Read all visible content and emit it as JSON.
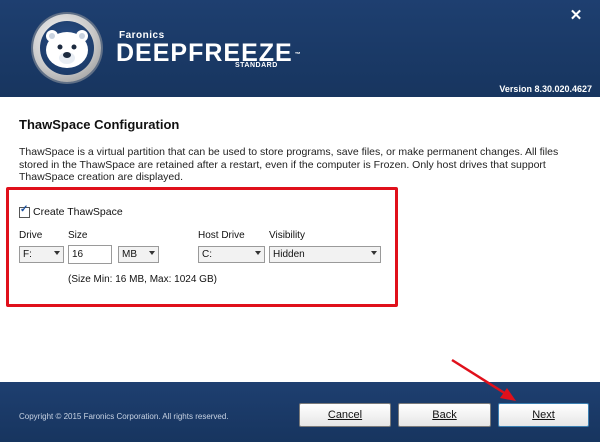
{
  "header": {
    "brand_small": "Faronics",
    "brand_main": "DEEPFREEZE",
    "brand_edition": "STANDARD",
    "version": "Version 8.30.020.4627",
    "close_glyph": "✕"
  },
  "page": {
    "title": "ThawSpace Configuration",
    "description": "ThawSpace is a virtual partition that can be used to store programs, save files, or make permanent changes. All files stored in the ThawSpace are retained after a restart, even if the computer is Frozen. Only host drives that support ThawSpace creation are displayed."
  },
  "form": {
    "create_label": "Create ThawSpace",
    "create_checked": true,
    "drive_label": "Drive",
    "drive_value": "F:",
    "size_label": "Size",
    "size_value": "16",
    "unit_value": "MB",
    "host_drive_label": "Host Drive",
    "host_drive_value": "C:",
    "visibility_label": "Visibility",
    "visibility_value": "Hidden",
    "size_note": "(Size Min: 16 MB, Max: 1024 GB)"
  },
  "footer": {
    "copyright": "Copyright © 2015 Faronics Corporation. All rights reserved.",
    "cancel_label": "Cancel",
    "back_label": "Back",
    "next_label": "Next"
  },
  "colors": {
    "header_bg": "#1e3f70",
    "highlight_red": "#e0101b"
  }
}
